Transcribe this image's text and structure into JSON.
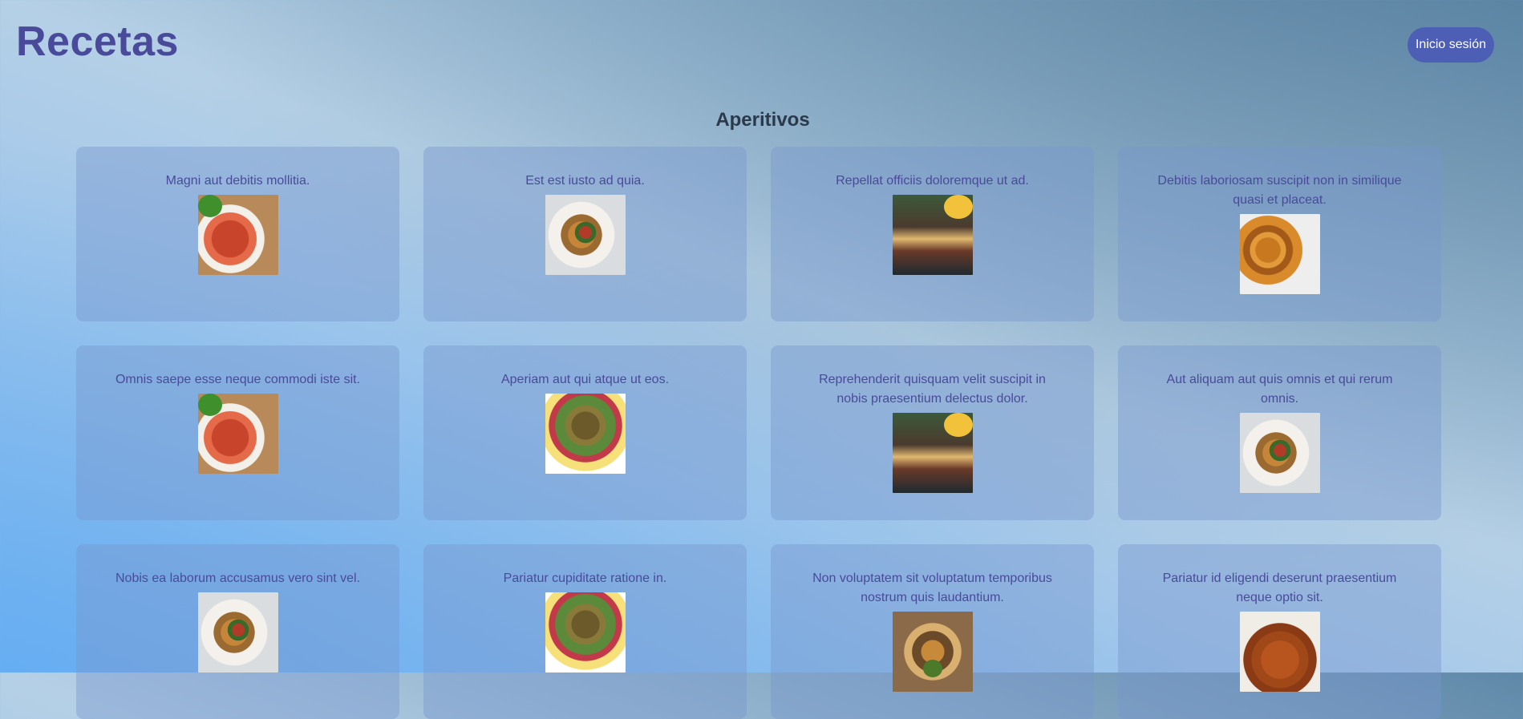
{
  "header": {
    "brand": "Recetas",
    "login_label": "Inicio sesión"
  },
  "section": {
    "title": "Aperitivos"
  },
  "cards": [
    {
      "title": "Magni aut debitis mollitia.",
      "image": "lasagna-image"
    },
    {
      "title": "Est est iusto ad quia.",
      "image": "pasta-image"
    },
    {
      "title": "Repellat officiis doloremque ut ad.",
      "image": "tacos-image"
    },
    {
      "title": "Debitis laboriosam suscipit non in similique quasi et placeat.",
      "image": "potatoes-image"
    },
    {
      "title": "Omnis saepe esse neque commodi iste sit.",
      "image": "lasagna-image"
    },
    {
      "title": "Aperiam aut qui atque ut eos.",
      "image": "falafel-image"
    },
    {
      "title": "Reprehenderit quisquam velit suscipit in nobis praesentium delectus dolor.",
      "image": "tacos-image"
    },
    {
      "title": "Aut aliquam aut quis omnis et qui rerum omnis.",
      "image": "pasta-image"
    },
    {
      "title": "Nobis ea laborum accusamus vero sint vel.",
      "image": "pasta-image"
    },
    {
      "title": "Pariatur cupiditate ratione in.",
      "image": "falafel-image"
    },
    {
      "title": "Non voluptatem sit voluptatum temporibus nostrum quis laudantium.",
      "image": "tacos-image"
    },
    {
      "title": "Pariatur id eligendi deserunt praesentium neque optio sit.",
      "image": "stew-image"
    }
  ],
  "colors": {
    "brand": "#4a4a9a",
    "button": "#4d5fb5"
  }
}
